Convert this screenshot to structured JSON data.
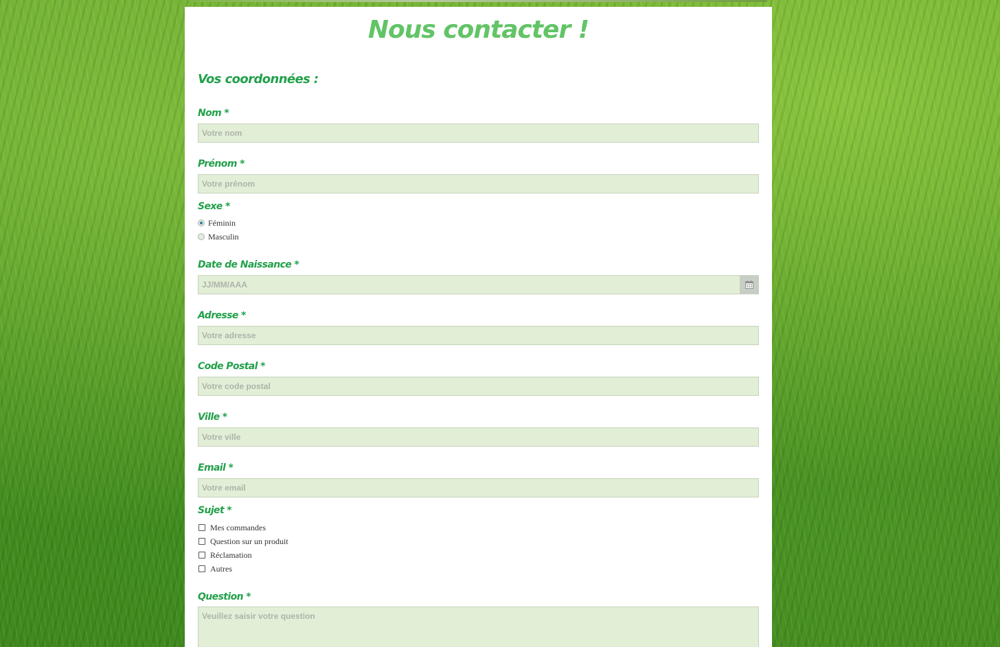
{
  "page": {
    "title": "Nous contacter !",
    "section_title": "Vos coordonnées :"
  },
  "colors": {
    "heading": "#62c466",
    "label": "#22a04a",
    "field_background": "#e2efd6",
    "card_background": "#ffffff"
  },
  "form": {
    "nom": {
      "label": "Nom *",
      "placeholder": "Votre nom"
    },
    "prenom": {
      "label": "Prénom *",
      "placeholder": "Votre prénom"
    },
    "sexe": {
      "label": "Sexe *",
      "options": [
        "Féminin",
        "Masculin"
      ],
      "selected": "Féminin"
    },
    "date_naissance": {
      "label": "Date de Naissance *",
      "placeholder": "JJ/MM/AAA",
      "icon": "calendar-icon"
    },
    "adresse": {
      "label": "Adresse *",
      "placeholder": "Votre adresse"
    },
    "code_postal": {
      "label": "Code Postal *",
      "placeholder": "Votre code postal"
    },
    "ville": {
      "label": "Ville *",
      "placeholder": "Votre ville"
    },
    "email": {
      "label": "Email *",
      "placeholder": "Votre email"
    },
    "sujet": {
      "label": "Sujet *",
      "options": [
        "Mes commandes",
        "Question sur un produit",
        "Réclamation",
        "Autres"
      ],
      "checked": []
    },
    "question": {
      "label": "Question *",
      "placeholder": "Veuillez saisir votre question"
    }
  }
}
